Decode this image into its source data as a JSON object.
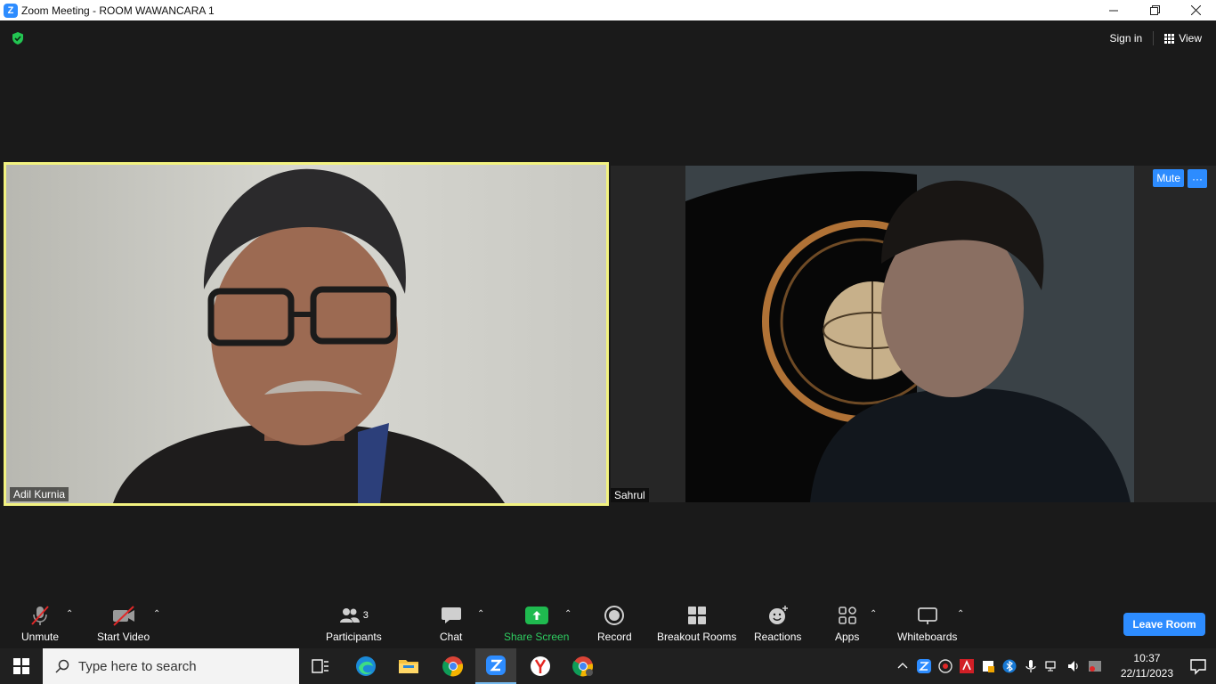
{
  "window": {
    "logo": "Z",
    "title": "Zoom Meeting - ROOM WAWANCARA 1",
    "controls": [
      "minimize-icon",
      "restore-icon",
      "close-icon"
    ]
  },
  "top_bar": {
    "sign_in": "Sign in",
    "view": "View"
  },
  "participants": [
    {
      "name": "Adil Kurnia",
      "active_speaker": true
    },
    {
      "name": "Sahrul",
      "active_speaker": false
    }
  ],
  "tile_b": {
    "mute": "Mute",
    "more": "···"
  },
  "toolbar": {
    "unmute": "Unmute",
    "start_video": "Start Video",
    "participants": "Participants",
    "participants_count": "3",
    "chat": "Chat",
    "share_screen": "Share Screen",
    "record": "Record",
    "breakout_rooms": "Breakout Rooms",
    "reactions": "Reactions",
    "apps": "Apps",
    "whiteboards": "Whiteboards",
    "leave": "Leave Room"
  },
  "taskbar": {
    "search_placeholder": "Type here to search",
    "time": "10:37",
    "date": "22/11/2023"
  },
  "colors": {
    "accent": "#2d8cff",
    "share_green": "#1fba4f",
    "speaker_border": "#f2f280",
    "background": "#1a1a1a"
  }
}
